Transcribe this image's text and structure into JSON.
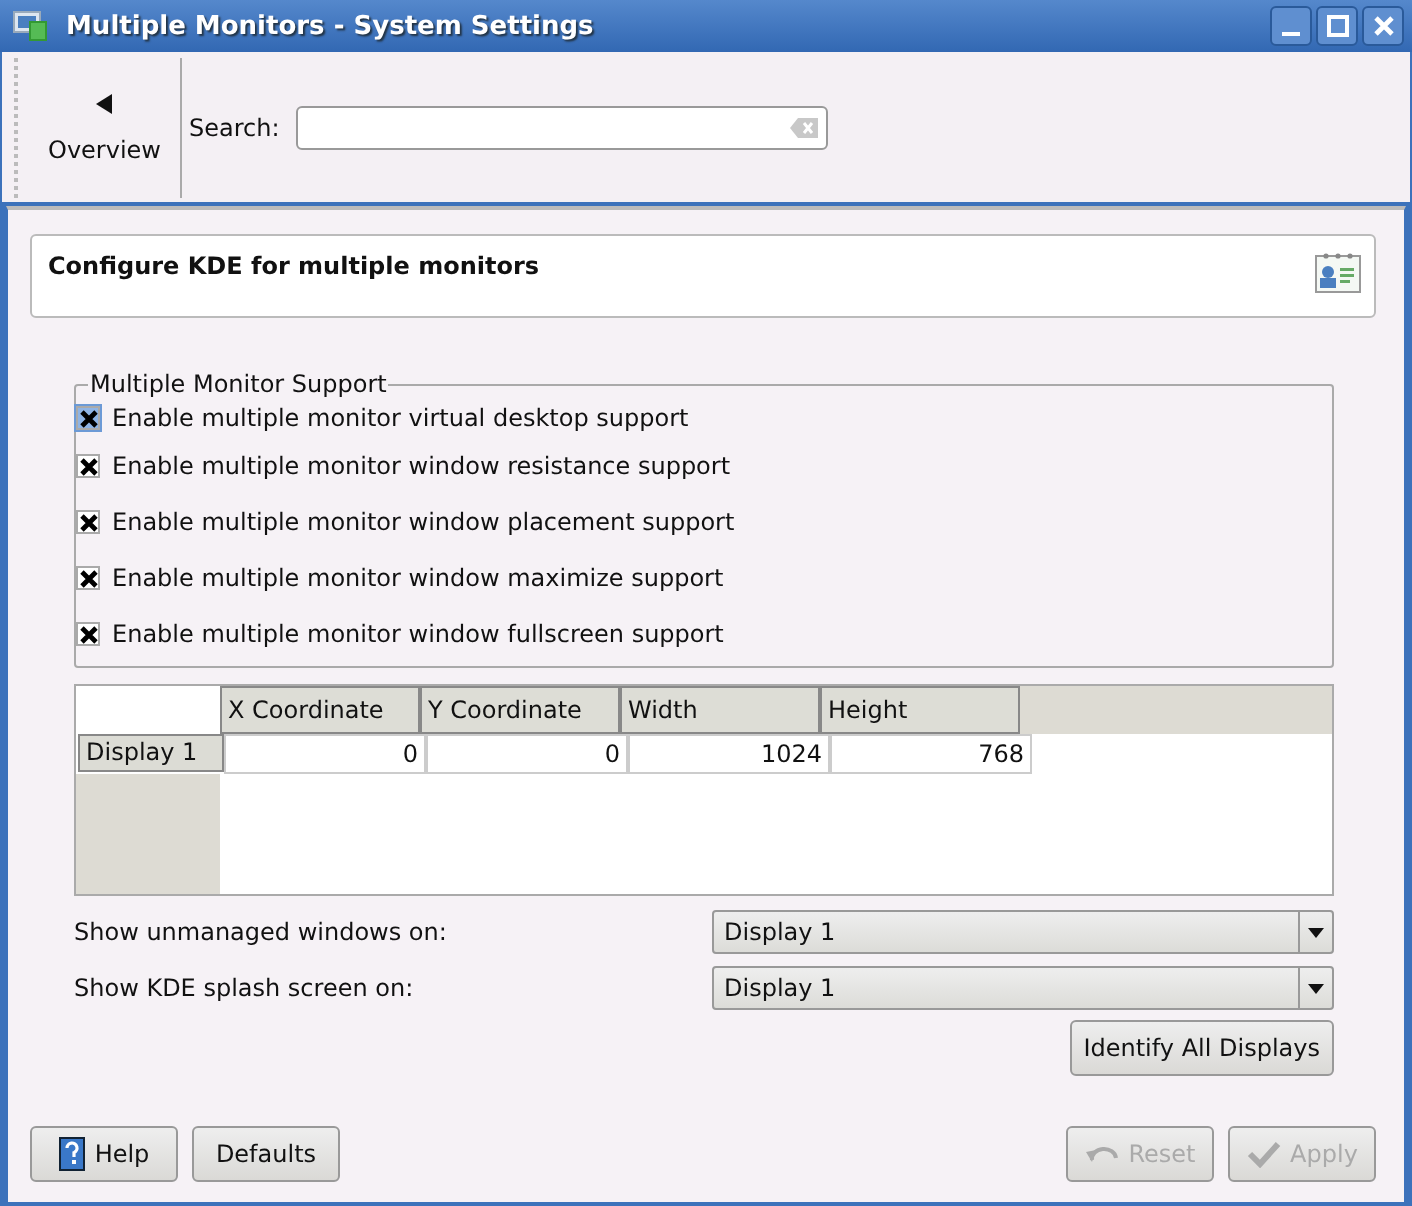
{
  "window": {
    "title": "Multiple Monitors - System Settings"
  },
  "toolbar": {
    "back_label": "Overview",
    "search_label": "Search:"
  },
  "header": {
    "title": "Configure KDE for multiple monitors"
  },
  "group": {
    "title": "Multiple Monitor Support",
    "options": [
      {
        "label": "Enable multiple monitor virtual desktop support",
        "checked": true,
        "focused": true
      },
      {
        "label": "Enable multiple monitor window resistance support",
        "checked": true,
        "focused": false
      },
      {
        "label": "Enable multiple monitor window placement support",
        "checked": true,
        "focused": false
      },
      {
        "label": "Enable multiple monitor window maximize support",
        "checked": true,
        "focused": false
      },
      {
        "label": "Enable multiple monitor window fullscreen support",
        "checked": true,
        "focused": false
      }
    ]
  },
  "table": {
    "columns": [
      "X Coordinate",
      "Y Coordinate",
      "Width",
      "Height"
    ],
    "rows": [
      {
        "header": "Display 1",
        "cells": [
          "0",
          "0",
          "1024",
          "768"
        ]
      }
    ]
  },
  "selects": [
    {
      "label": "Show unmanaged windows on:",
      "value": "Display 1"
    },
    {
      "label": "Show KDE splash screen on:",
      "value": "Display 1"
    }
  ],
  "identify_button": "Identify All Displays",
  "buttons": [
    {
      "kind": "help",
      "label": "Help",
      "disabled": false
    },
    {
      "kind": "plain",
      "label": "Defaults",
      "disabled": false
    },
    {
      "kind": "reset",
      "label": "Reset",
      "disabled": true
    },
    {
      "kind": "apply",
      "label": "Apply",
      "disabled": true
    }
  ]
}
